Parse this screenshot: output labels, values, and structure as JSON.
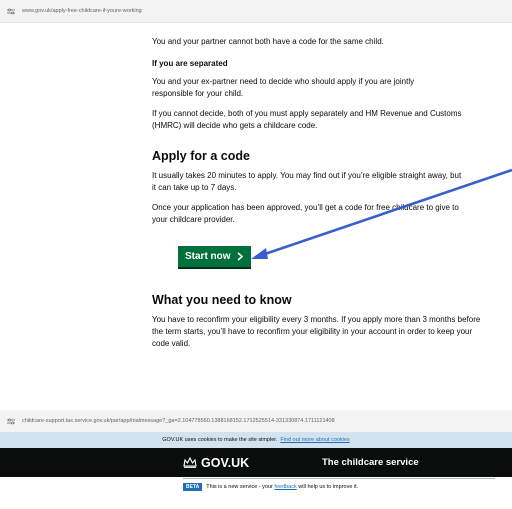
{
  "top_url": "www.gov.uk/apply-free-childcare-if-youre-working",
  "page": {
    "intro_para": "You and your partner cannot both have a code for the same child.",
    "separated_heading": "If you are separated",
    "separated_para_1": "You and your ex-partner need to decide who should apply if you are jointly responsible for your child.",
    "separated_para_2": "If you cannot decide, both of you must apply separately and HM Revenue and Customs (HMRC) will decide who gets a childcare code.",
    "apply_heading": "Apply for a code",
    "apply_para_1": "It usually takes 20 minutes to apply. You may find out if you’re eligible straight away, but it can take up to 7 days.",
    "apply_para_2": "Once your application has been approved, you’ll get a code for free childcare to give to your childcare provider.",
    "start_button": "Start now",
    "need_heading": "What you need to know",
    "need_para": "You have to reconfirm your eligibility every 3 months. If you apply more than 3 months before the term starts, you’ll have to reconfirm your eligibility in your account in order to keep your code valid."
  },
  "bottom_url": "childcare-support.tax.service.gov.uk/par/app/trialmessage?_ga=2.104778560.1388168152.1712525514-331330874.1711121408",
  "cookie": {
    "text": "GOV.UK uses cookies to make the site simpler.",
    "link": "Find out more about cookies"
  },
  "header": {
    "logo": "GOV.UK",
    "service": "The childcare service"
  },
  "beta": {
    "tag": "BETA",
    "pre": "This is a new service - your",
    "link": "feedback",
    "post": "will help us to improve it."
  },
  "colors": {
    "button_green": "#00703c",
    "link_blue": "#1d70b8",
    "annotation_arrow": "#3a5fcd",
    "header_black": "#0b0c0c"
  }
}
